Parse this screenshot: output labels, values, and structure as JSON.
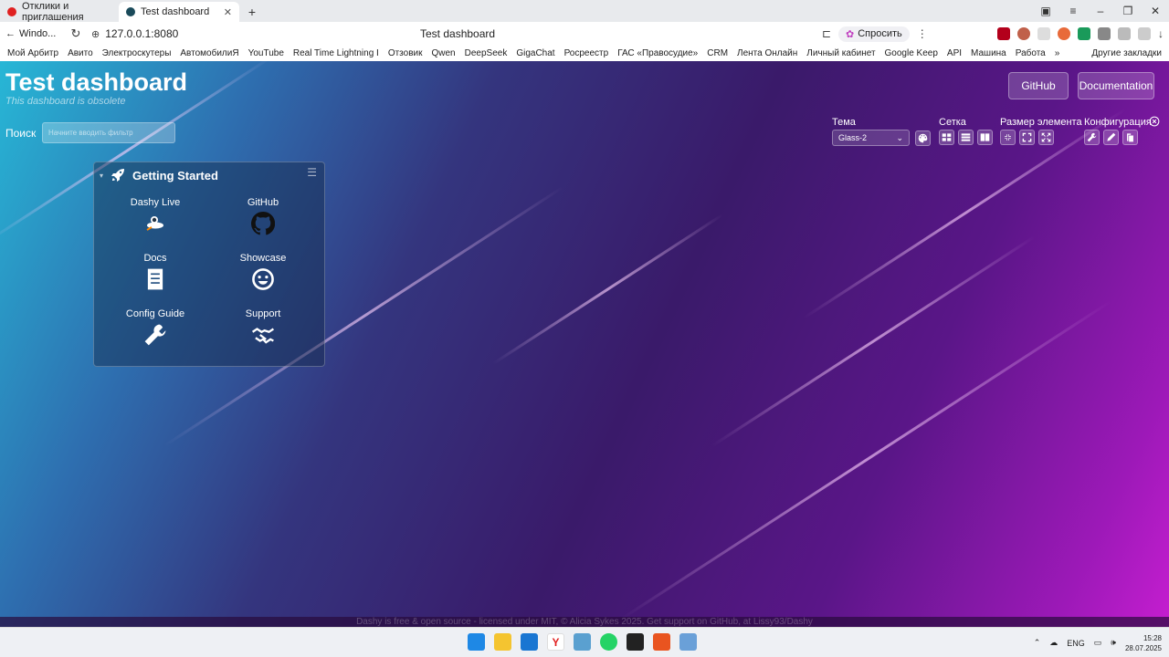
{
  "browser": {
    "tabs": [
      {
        "label": "Отклики и приглашения",
        "active": false
      },
      {
        "label": "Test dashboard",
        "active": true
      }
    ],
    "back_label": "Windo...",
    "url": "127.0.0.1:8080",
    "page_title": "Test dashboard",
    "ask_label": "Спросить",
    "bookmarks": [
      "Мой Арбитр",
      "Авито",
      "Электроскутеры",
      "АвтомобилиЯ",
      "YouTube",
      "Real Time Lightning I",
      "Отзовик",
      "Qwen",
      "DeepSeek",
      "GigaChat",
      "Росреестр",
      "ГАС «Правосудие»",
      "CRM",
      "Лента Онлайн",
      "Личный кабинет",
      "Google Keep",
      "API",
      "Машина",
      "Работа",
      "»"
    ],
    "other_bookmarks": "Другие закладки"
  },
  "dashboard": {
    "title": "Test dashboard",
    "subtitle": "This dashboard is obsolete",
    "nav": {
      "github": "GitHub",
      "documentation": "Documentation"
    },
    "search": {
      "label": "Поиск",
      "placeholder": "Начните вводить фильтр"
    },
    "settings": {
      "theme_label": "Тема",
      "theme_value": "Glass-2",
      "layout_label": "Сетка",
      "size_label": "Размер элемента",
      "config_label": "Конфигурация"
    },
    "section": {
      "title": "Getting Started",
      "items": [
        {
          "label": "Dashy Live",
          "icon": "rocket-astronaut-icon"
        },
        {
          "label": "GitHub",
          "icon": "github-icon"
        },
        {
          "label": "Docs",
          "icon": "book-icon"
        },
        {
          "label": "Showcase",
          "icon": "smiley-icon"
        },
        {
          "label": "Config Guide",
          "icon": "wrench-icon"
        },
        {
          "label": "Support",
          "icon": "handshake-icon"
        }
      ]
    },
    "footer": "Dashy is free & open source - licensed under MIT, © Alicia Sykes 2025. Get support on GitHub, at Lissy93/Dashy"
  },
  "taskbar": {
    "lang": "ENG",
    "time": "15:28",
    "date": "28.07.2025"
  }
}
